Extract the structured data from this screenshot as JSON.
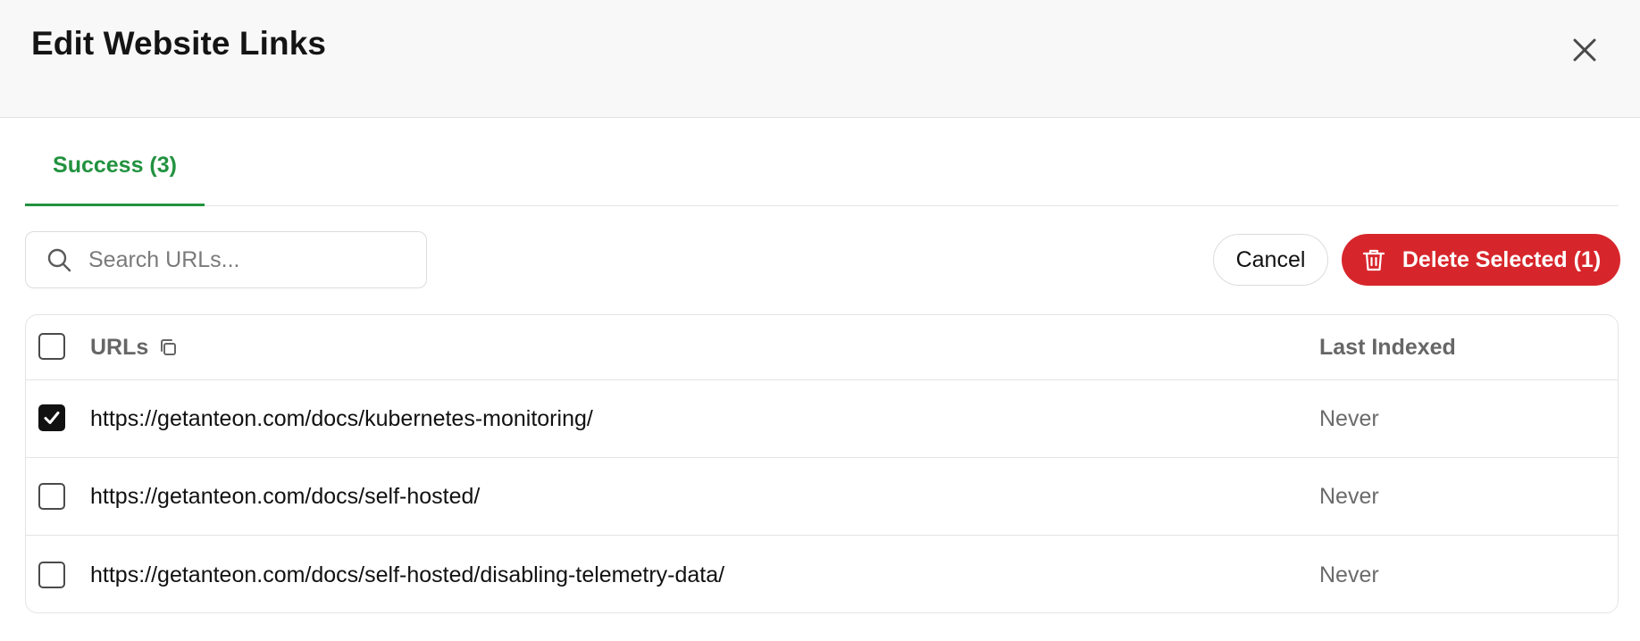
{
  "dialog": {
    "title": "Edit Website Links"
  },
  "tabs": [
    {
      "label": "Success (3)",
      "active": true
    }
  ],
  "search": {
    "placeholder": "Search URLs...",
    "value": ""
  },
  "actions": {
    "cancel_label": "Cancel",
    "delete_label": "Delete Selected (1)"
  },
  "table": {
    "headers": {
      "url": "URLs",
      "last_indexed": "Last Indexed"
    },
    "rows": [
      {
        "url": "https://getanteon.com/docs/kubernetes-monitoring/",
        "last_indexed": "Never",
        "checked": true
      },
      {
        "url": "https://getanteon.com/docs/self-hosted/",
        "last_indexed": "Never",
        "checked": false
      },
      {
        "url": "https://getanteon.com/docs/self-hosted/disabling-telemetry-data/",
        "last_indexed": "Never",
        "checked": false
      }
    ]
  },
  "colors": {
    "accent_green": "#22923f",
    "danger_red": "#d7262b",
    "header_bg": "#f8f8f8"
  },
  "icons": {
    "close": "close-icon",
    "search": "search-icon",
    "trash": "trash-icon",
    "copy": "copy-icon",
    "check": "check-icon"
  }
}
